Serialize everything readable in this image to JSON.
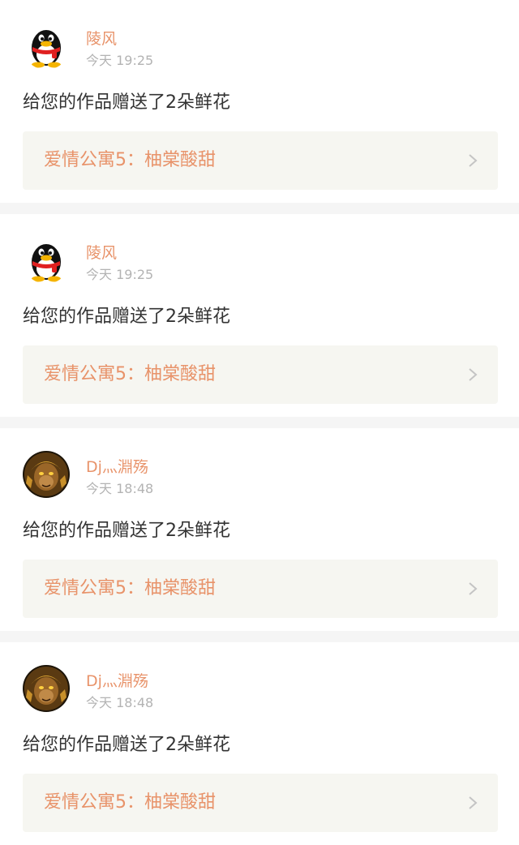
{
  "notifications": [
    {
      "avatar_icon": "qq-penguin-avatar",
      "username": "陵风",
      "time": "今天 19:25",
      "message": "给您的作品赠送了2朵鲜花",
      "work_title": "爱情公寓5：柚棠酸甜"
    },
    {
      "avatar_icon": "qq-penguin-avatar",
      "username": "陵风",
      "time": "今天 19:25",
      "message": "给您的作品赠送了2朵鲜花",
      "work_title": "爱情公寓5：柚棠酸甜"
    },
    {
      "avatar_icon": "golden-monkey-avatar",
      "username": "Dj灬淵殇",
      "time": "今天 18:48",
      "message": "给您的作品赠送了2朵鲜花",
      "work_title": "爱情公寓5：柚棠酸甜"
    },
    {
      "avatar_icon": "golden-monkey-avatar",
      "username": "Dj灬淵殇",
      "time": "今天 18:48",
      "message": "给您的作品赠送了2朵鲜花",
      "work_title": "爱情公寓5：柚棠酸甜"
    }
  ],
  "colors": {
    "accent": "#e8936a",
    "text": "#333333",
    "muted": "#b3b3b3",
    "link_bg": "#f6f6f1",
    "page_bg": "#f5f5f5"
  },
  "icons": {
    "chevron": "chevron-right-icon"
  }
}
